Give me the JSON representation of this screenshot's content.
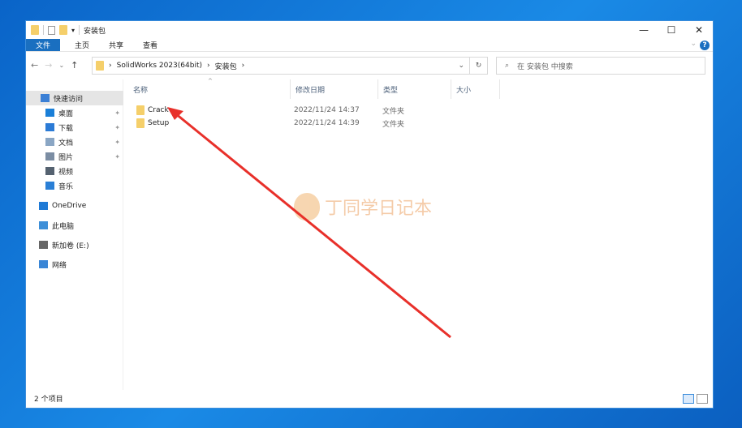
{
  "window": {
    "title": "安装包",
    "minimize": "—",
    "maximize": "☐",
    "close": "✕"
  },
  "ribbon": {
    "tabs": [
      "文件",
      "主页",
      "共享",
      "查看"
    ],
    "help": "?",
    "expand": "⌄"
  },
  "nav": {
    "back": "←",
    "forward": "→",
    "recent": "⌄",
    "up": "↑",
    "breadcrumb": [
      "SolidWorks 2023(64bit)",
      "安装包"
    ],
    "sep": "›",
    "dropdown": "⌄",
    "refresh": "↻",
    "search_placeholder": "在 安装包 中搜索"
  },
  "sidebar": {
    "items": [
      {
        "label": "快速访问",
        "icon": "star-icon",
        "color": "#3a7fd5"
      },
      {
        "label": "桌面",
        "icon": "desktop-icon",
        "color": "#1a7fd8",
        "pinned": true
      },
      {
        "label": "下载",
        "icon": "download-icon",
        "color": "#2b7bd6",
        "pinned": true
      },
      {
        "label": "文档",
        "icon": "document-icon",
        "color": "#8aa6c4",
        "pinned": true
      },
      {
        "label": "图片",
        "icon": "pictures-icon",
        "color": "#7b8da3",
        "pinned": true
      },
      {
        "label": "视频",
        "icon": "video-icon",
        "color": "#556270"
      },
      {
        "label": "音乐",
        "icon": "music-icon",
        "color": "#2a7fd6"
      },
      {
        "label": "OneDrive",
        "icon": "cloud-icon",
        "color": "#1f7ad6"
      },
      {
        "label": "此电脑",
        "icon": "computer-icon",
        "color": "#3d8fd8"
      },
      {
        "label": "新加卷 (E:)",
        "icon": "drive-icon",
        "color": "#666666"
      },
      {
        "label": "网络",
        "icon": "network-icon",
        "color": "#3a86d6"
      }
    ],
    "pin": "📌"
  },
  "columns": [
    "名称",
    "修改日期",
    "类型",
    "大小"
  ],
  "files": [
    {
      "name": "Crack",
      "date": "2022/11/24 14:37",
      "type": "文件夹"
    },
    {
      "name": "Setup",
      "date": "2022/11/24 14:39",
      "type": "文件夹"
    }
  ],
  "status": "2 个项目",
  "watermark": "丁同学日记本",
  "colors": {
    "accent": "#1a6fc0",
    "arrow": "#e8302a",
    "folder": "#f5cf6a"
  }
}
